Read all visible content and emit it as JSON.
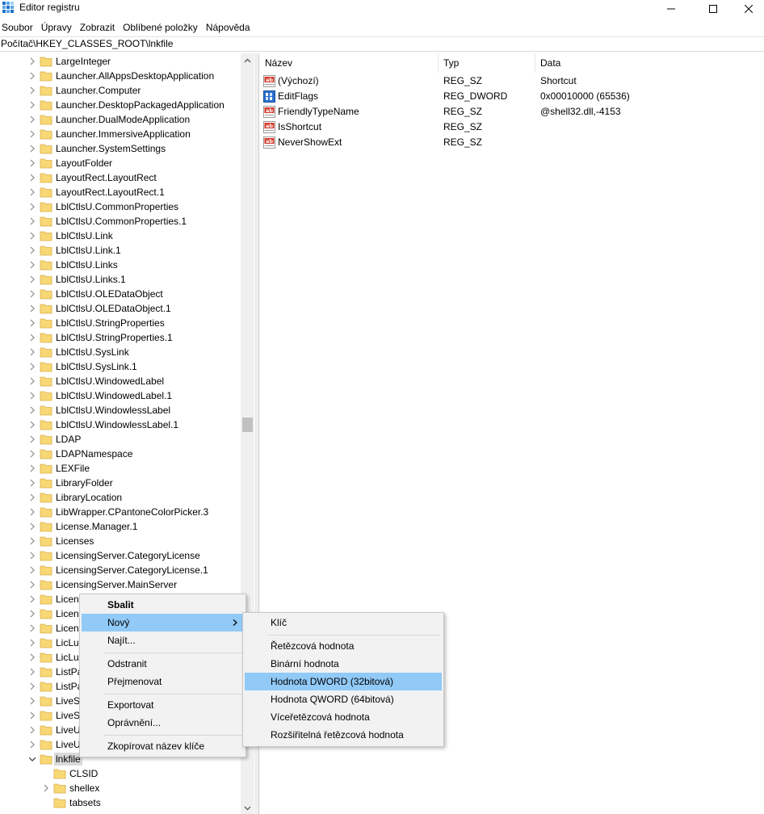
{
  "window": {
    "title": "Editor registru",
    "minimize_icon": "minimize-icon",
    "maximize_icon": "maximize-icon",
    "close_icon": "close-icon"
  },
  "menubar": {
    "items": [
      "Soubor",
      "Úpravy",
      "Zobrazit",
      "Oblíbené položky",
      "Nápověda"
    ]
  },
  "address": {
    "path": "Počítač\\HKEY_CLASSES_ROOT\\lnkfile"
  },
  "tree": {
    "items": [
      {
        "label": "LargeInteger",
        "expandable": true
      },
      {
        "label": "Launcher.AllAppsDesktopApplication",
        "expandable": true
      },
      {
        "label": "Launcher.Computer",
        "expandable": true
      },
      {
        "label": "Launcher.DesktopPackagedApplication",
        "expandable": true
      },
      {
        "label": "Launcher.DualModeApplication",
        "expandable": true
      },
      {
        "label": "Launcher.ImmersiveApplication",
        "expandable": true
      },
      {
        "label": "Launcher.SystemSettings",
        "expandable": true
      },
      {
        "label": "LayoutFolder",
        "expandable": true
      },
      {
        "label": "LayoutRect.LayoutRect",
        "expandable": true
      },
      {
        "label": "LayoutRect.LayoutRect.1",
        "expandable": true
      },
      {
        "label": "LblCtlsU.CommonProperties",
        "expandable": true
      },
      {
        "label": "LblCtlsU.CommonProperties.1",
        "expandable": true
      },
      {
        "label": "LblCtlsU.Link",
        "expandable": true
      },
      {
        "label": "LblCtlsU.Link.1",
        "expandable": true
      },
      {
        "label": "LblCtlsU.Links",
        "expandable": true
      },
      {
        "label": "LblCtlsU.Links.1",
        "expandable": true
      },
      {
        "label": "LblCtlsU.OLEDataObject",
        "expandable": true
      },
      {
        "label": "LblCtlsU.OLEDataObject.1",
        "expandable": true
      },
      {
        "label": "LblCtlsU.StringProperties",
        "expandable": true
      },
      {
        "label": "LblCtlsU.StringProperties.1",
        "expandable": true
      },
      {
        "label": "LblCtlsU.SysLink",
        "expandable": true
      },
      {
        "label": "LblCtlsU.SysLink.1",
        "expandable": true
      },
      {
        "label": "LblCtlsU.WindowedLabel",
        "expandable": true
      },
      {
        "label": "LblCtlsU.WindowedLabel.1",
        "expandable": true
      },
      {
        "label": "LblCtlsU.WindowlessLabel",
        "expandable": true
      },
      {
        "label": "LblCtlsU.WindowlessLabel.1",
        "expandable": true
      },
      {
        "label": "LDAP",
        "expandable": true
      },
      {
        "label": "LDAPNamespace",
        "expandable": true
      },
      {
        "label": "LEXFile",
        "expandable": true
      },
      {
        "label": "LibraryFolder",
        "expandable": true
      },
      {
        "label": "LibraryLocation",
        "expandable": true
      },
      {
        "label": "LibWrapper.CPantoneColorPicker.3",
        "expandable": true
      },
      {
        "label": "License.Manager.1",
        "expandable": true
      },
      {
        "label": "Licenses",
        "expandable": true
      },
      {
        "label": "LicensingServer.CategoryLicense",
        "expandable": true
      },
      {
        "label": "LicensingServer.CategoryLicense.1",
        "expandable": true
      },
      {
        "label": "LicensingServer.MainServer",
        "expandable": true
      },
      {
        "label": "Licen",
        "expandable": true
      },
      {
        "label": "Licen",
        "expandable": true
      },
      {
        "label": "Licen",
        "expandable": true
      },
      {
        "label": "LicLu",
        "expandable": true
      },
      {
        "label": "LicLu",
        "expandable": true
      },
      {
        "label": "ListPa",
        "expandable": true
      },
      {
        "label": "ListPa",
        "expandable": true
      },
      {
        "label": "LiveSe",
        "expandable": true
      },
      {
        "label": "LiveSe",
        "expandable": true
      },
      {
        "label": "LiveU",
        "expandable": true
      },
      {
        "label": "LiveU",
        "expandable": true
      },
      {
        "label": "lnkfile",
        "expandable": true,
        "expanded": true,
        "selected": true
      },
      {
        "label": "CLSID",
        "expandable": false,
        "child": true
      },
      {
        "label": "shellex",
        "expandable": true,
        "child": true
      },
      {
        "label": "tabsets",
        "expandable": false,
        "child": true
      }
    ]
  },
  "list": {
    "headers": {
      "name": "Název",
      "type": "Typ",
      "data": "Data"
    },
    "rows": [
      {
        "name": "(Výchozí)",
        "type": "REG_SZ",
        "data": "Shortcut",
        "icon": "string-value-icon"
      },
      {
        "name": "EditFlags",
        "type": "REG_DWORD",
        "data": "0x00010000 (65536)",
        "icon": "binary-value-icon"
      },
      {
        "name": "FriendlyTypeName",
        "type": "REG_SZ",
        "data": "@shell32.dll,-4153",
        "icon": "string-value-icon"
      },
      {
        "name": "IsShortcut",
        "type": "REG_SZ",
        "data": "",
        "icon": "string-value-icon"
      },
      {
        "name": "NeverShowExt",
        "type": "REG_SZ",
        "data": "",
        "icon": "string-value-icon"
      }
    ]
  },
  "context_menu": {
    "items": {
      "collapse": "Sbalit",
      "new": "Nový",
      "find": "Najít...",
      "delete": "Odstranit",
      "rename": "Přejmenovat",
      "export": "Exportovat",
      "permissions": "Oprávnění...",
      "copy_key_name": "Zkopírovat název klíče"
    }
  },
  "new_submenu": {
    "items": {
      "key": "Klíč",
      "string": "Řetězcová hodnota",
      "binary": "Binární hodnota",
      "dword": "Hodnota DWORD (32bitová)",
      "qword": "Hodnota QWORD (64bitová)",
      "multi_string": "Víceřetězcová hodnota",
      "expandable_string": "Rozšiřitelná řetězcová hodnota"
    }
  },
  "colors": {
    "highlight": "#91c9f7",
    "selected_tree": "#d9d9d9",
    "folder": "#f8d775",
    "menu_bg": "#f2f2f2"
  }
}
